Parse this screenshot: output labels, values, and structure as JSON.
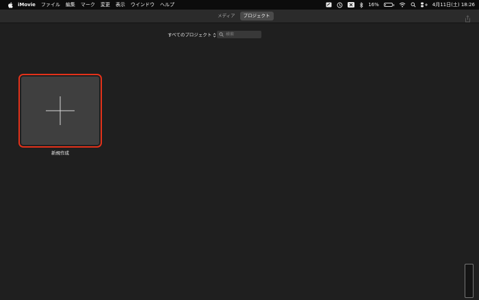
{
  "menubar": {
    "items": [
      "iMovie",
      "ファイル",
      "編集",
      "マーク",
      "変更",
      "表示",
      "ウインドウ",
      "ヘルプ"
    ],
    "battery_text": "16%",
    "battery_level": 0.16,
    "datetime": "4月11日(土)  18:26"
  },
  "toolbar": {
    "tabs": [
      {
        "label": "メディア",
        "active": false
      },
      {
        "label": "プロジェクト",
        "active": true
      }
    ]
  },
  "filter": {
    "selected": "すべてのプロジェクト",
    "search_placeholder": "検索"
  },
  "new_project": {
    "label": "新規作成",
    "border_color": "#e5321a"
  }
}
